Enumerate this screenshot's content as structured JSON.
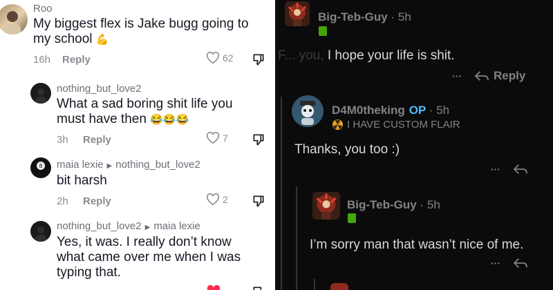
{
  "left": {
    "comments": [
      {
        "username": "Roo",
        "text_line1": "My biggest flex is Jake bugg going to",
        "text_line2": "my school",
        "emoji": "💪",
        "time": "16h",
        "reply_label": "Reply",
        "likes": "62"
      },
      {
        "username": "nothing_but_love2",
        "text_line1": "What a sad boring shit life you",
        "text_line2": "must have then",
        "emoji": "😂😂😂",
        "time": "3h",
        "reply_label": "Reply",
        "likes": "7"
      },
      {
        "username": "maia lexie",
        "reply_to": "nothing_but_love2",
        "text_line1": "bit harsh",
        "time": "2h",
        "reply_label": "Reply",
        "likes": "2"
      },
      {
        "username": "nothing_but_love2",
        "reply_to": "maia lexie",
        "text_line1": "Yes, it was. I really don’t know",
        "text_line2": "what came over me when I was",
        "text_line3": "typing that."
      }
    ],
    "colors": {
      "like_active": "#fe2c55",
      "muted": "#8a8b91"
    }
  },
  "right": {
    "comments": [
      {
        "username": "Big-Teb-Guy",
        "age": "5h",
        "body_faded": "F... you, ",
        "body": "I hope your life is shit.",
        "reply_label": "Reply"
      },
      {
        "username": "D4M0theking",
        "op_badge": "OP",
        "age": "5h",
        "flair": "I HAVE CUSTOM FLAIR",
        "body": "Thanks, you too :)"
      },
      {
        "username": "Big-Teb-Guy",
        "age": "5h",
        "body": "I’m sorry man that wasn’t nice of me."
      }
    ],
    "separator": "·",
    "more_glyph": "···",
    "colors": {
      "op": "#4fbdff",
      "text": "#d7dadc",
      "muted": "#818384",
      "background": "#0b0b0c"
    }
  }
}
